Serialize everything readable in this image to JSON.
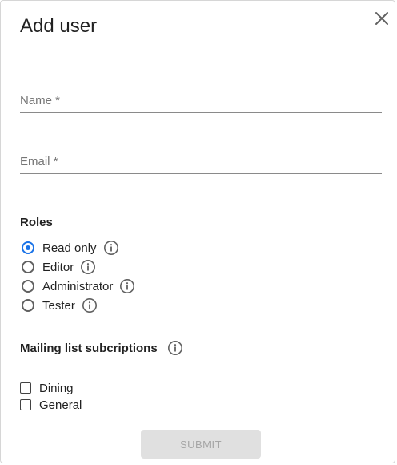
{
  "dialog": {
    "title": "Add user",
    "close_icon": "close-icon"
  },
  "form": {
    "name_label": "Name *",
    "name_value": "",
    "email_label": "Email *",
    "email_value": ""
  },
  "roles": {
    "title": "Roles",
    "selected": "Read only",
    "options": [
      {
        "label": "Read only",
        "checked": true
      },
      {
        "label": "Editor",
        "checked": false
      },
      {
        "label": "Administrator",
        "checked": false
      },
      {
        "label": "Tester",
        "checked": false
      }
    ]
  },
  "mailing": {
    "title": "Mailing list subcriptions",
    "options": [
      {
        "label": "Dining",
        "checked": false
      },
      {
        "label": "General",
        "checked": false
      }
    ]
  },
  "actions": {
    "submit_label": "SUBMIT",
    "submit_disabled": true
  },
  "colors": {
    "accent": "#1a73e8",
    "disabled_bg": "#e0e0e0",
    "disabled_text": "#a6a6a6"
  }
}
